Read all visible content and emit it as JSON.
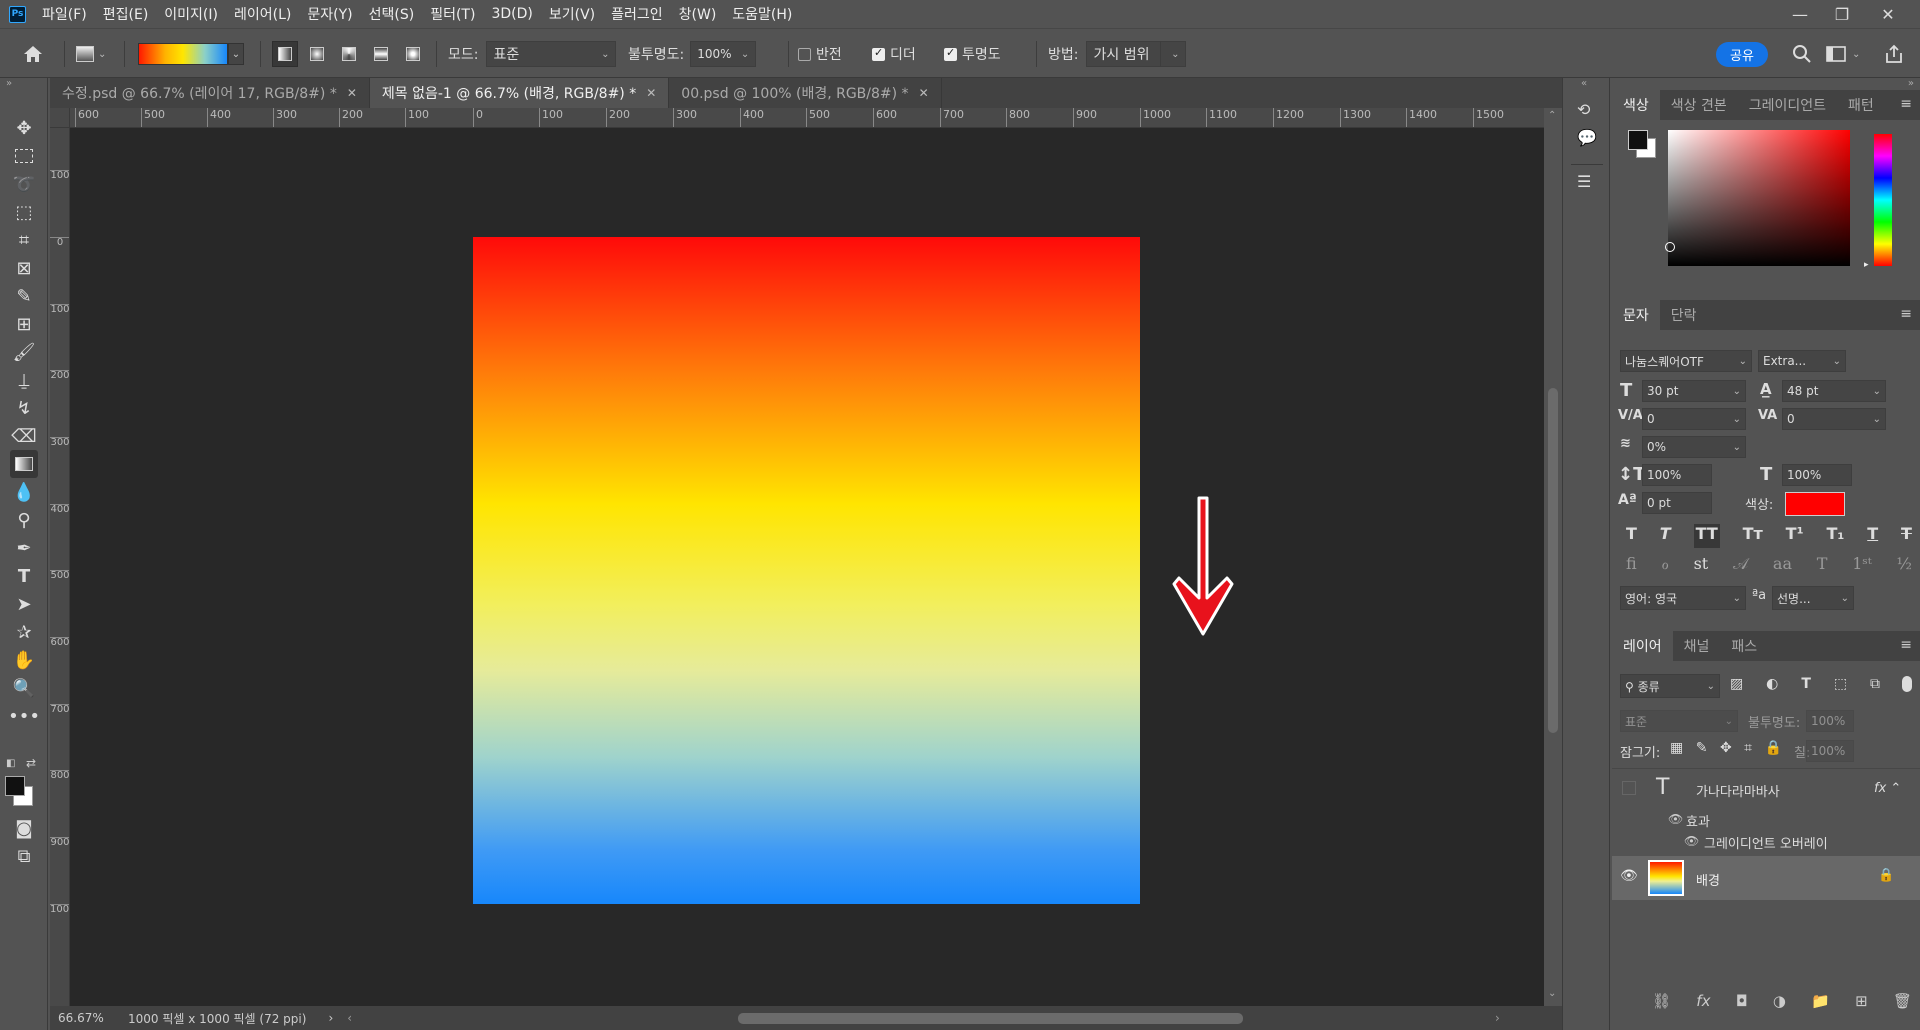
{
  "menubar": {
    "logo": "Ps",
    "items": [
      "파일(F)",
      "편집(E)",
      "이미지(I)",
      "레이어(L)",
      "문자(Y)",
      "선택(S)",
      "필터(T)",
      "3D(D)",
      "보기(V)",
      "플러그인",
      "창(W)",
      "도움말(H)"
    ]
  },
  "options": {
    "mode_label": "모드:",
    "mode_value": "표준",
    "opacity_label": "불투명도:",
    "opacity_value": "100%",
    "reverse_label": "반전",
    "dither_label": "디더",
    "transparency_label": "투명도",
    "method_label": "방법:",
    "method_value": "가시 범위",
    "share_label": "공유",
    "reverse_checked": false,
    "dither_checked": true,
    "transparency_checked": true
  },
  "tabs": [
    {
      "label": "수정.psd @ 66.7% (레이어 17, RGB/8#) *",
      "active": false
    },
    {
      "label": "제목 없음-1 @ 66.7% (배경, RGB/8#) *",
      "active": true
    },
    {
      "label": "00.psd @ 100% (배경, RGB/8#) *",
      "active": false
    }
  ],
  "ruler_h": [
    "600",
    "500",
    "400",
    "300",
    "200",
    "100",
    "0",
    "100",
    "200",
    "300",
    "400",
    "500",
    "600",
    "700",
    "800",
    "900",
    "1000",
    "1100",
    "1200",
    "1300",
    "1400",
    "1500"
  ],
  "ruler_v": [
    "100",
    "0",
    "100",
    "200",
    "300",
    "400",
    "500",
    "600",
    "700",
    "800",
    "900",
    "1000"
  ],
  "status": {
    "zoom": "66.67%",
    "doc_info": "1000 픽셀 x 1000 픽셀 (72 ppi)"
  },
  "color_panel": {
    "tabs": [
      "색상",
      "색상 견본",
      "그레이디언트",
      "패턴"
    ]
  },
  "char_panel": {
    "tabs": [
      "문자",
      "단락"
    ],
    "font_family": "나눔스퀘어OTF",
    "font_style": "Extra...",
    "size": "30 pt",
    "leading": "48 pt",
    "kerning": "0",
    "tracking": "0",
    "tsume": "0%",
    "vscale": "100%",
    "hscale": "100%",
    "baseline": "0 pt",
    "color_label": "색상:",
    "color_value": "#ff0000",
    "language": "영어: 영국",
    "antialias": "선명..."
  },
  "layers_panel": {
    "tabs": [
      "레이어",
      "채널",
      "패스"
    ],
    "filter_kind": "종류",
    "blend_mode": "표준",
    "opacity_label": "불투명도:",
    "opacity_value": "100%",
    "lock_label": "잠그기:",
    "fill_label": "칠:",
    "fill_value": "100%",
    "layers": [
      {
        "name": "가나다라마바사",
        "type": "text",
        "effects_label": "효과",
        "effect": "그레이디언트 오버레이",
        "visible": false
      },
      {
        "name": "배경",
        "type": "image",
        "visible": true,
        "locked": true
      }
    ]
  }
}
